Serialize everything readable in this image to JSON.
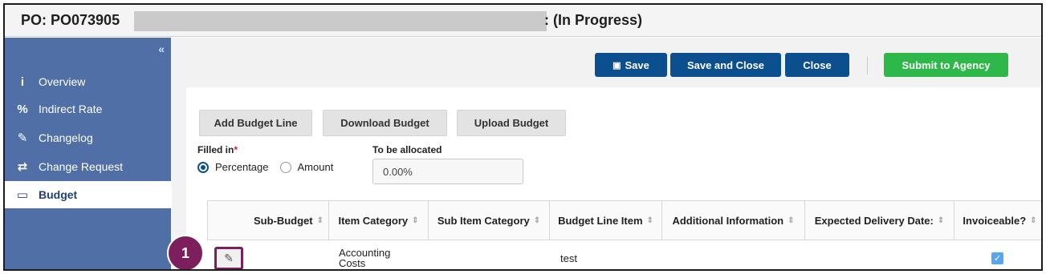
{
  "header": {
    "po_label": "PO: PO073905",
    "status": ": (In Progress)"
  },
  "sidebar": {
    "collapse_icon": "«",
    "items": [
      {
        "icon": "info-icon",
        "glyph": "i",
        "label": "Overview"
      },
      {
        "icon": "percent-icon",
        "glyph": "%",
        "label": "Indirect Rate"
      },
      {
        "icon": "edit-icon",
        "glyph": "✎",
        "label": "Changelog"
      },
      {
        "icon": "exchange-icon",
        "glyph": "⇄",
        "label": "Change Request"
      },
      {
        "icon": "money-icon",
        "glyph": "▭",
        "label": "Budget",
        "active": true
      }
    ]
  },
  "toolbar": {
    "save_label": "Save",
    "save_icon": "floppy-icon",
    "save_close_label": "Save and Close",
    "close_label": "Close",
    "submit_label": "Submit to Agency"
  },
  "budget": {
    "add_line_label": "Add Budget Line",
    "download_label": "Download Budget",
    "upload_label": "Upload Budget",
    "filled_in_label": "Filled in",
    "required_mark": "*",
    "options": [
      "Percentage",
      "Amount"
    ],
    "selected_option": "Percentage",
    "to_be_allocated_label": "To be allocated",
    "to_be_allocated_value": "0.00%"
  },
  "table": {
    "columns": [
      "Sub-Budget",
      "Item Category",
      "Sub Item Category",
      "Budget Line Item",
      "Additional Information",
      "Expected Delivery Date:",
      "Invoiceable?"
    ],
    "rows": [
      {
        "sub_budget": "",
        "item_category": "Accounting Costs",
        "sub_item_category": "",
        "budget_line_item": "test",
        "additional_information": "",
        "expected_delivery_date": "",
        "invoiceable": true
      }
    ]
  },
  "callout": {
    "number": "1"
  },
  "colors": {
    "sidebar": "#4f6fa6",
    "primary_button": "#0c4f8f",
    "submit_button": "#2fb84a",
    "callout": "#7d1f5d"
  }
}
